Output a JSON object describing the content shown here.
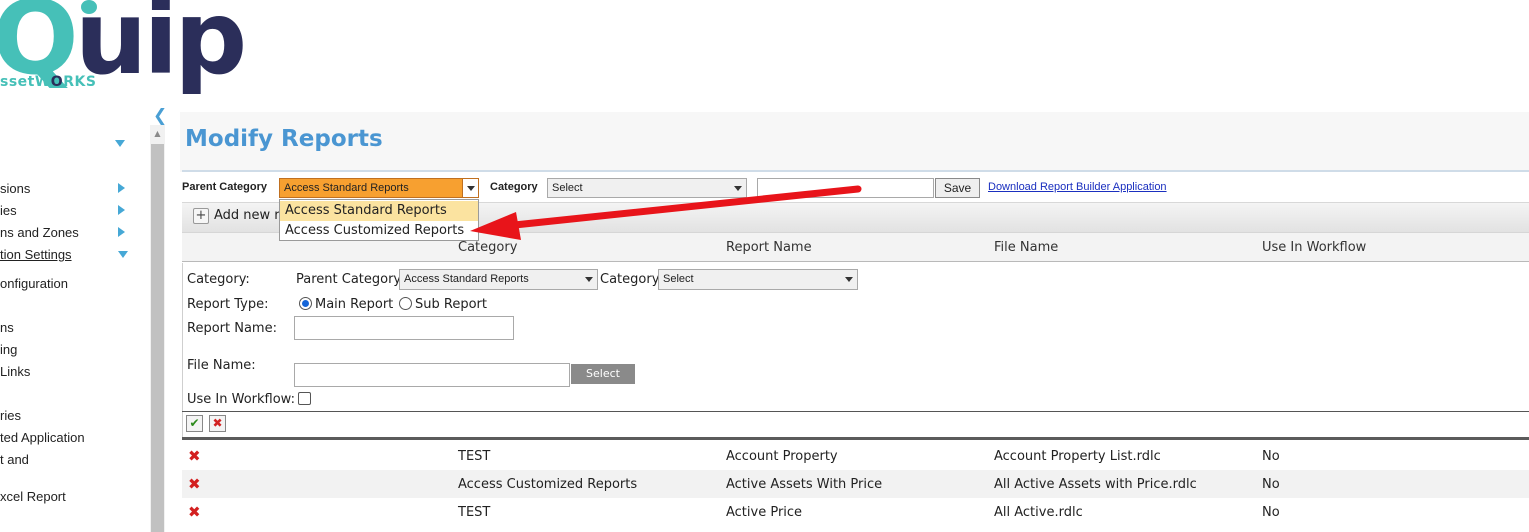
{
  "logo": {
    "word_first": "Q",
    "word_rest": "uip",
    "sub_prefix": "ssetW",
    "sub_o": "O",
    "sub_suffix": "RKS"
  },
  "sidebar": {
    "items": [
      {
        "label": "sions"
      },
      {
        "label": "ies"
      },
      {
        "label": "ns and Zones"
      },
      {
        "label": "tion Settings"
      },
      {
        "label": "onfiguration"
      },
      {
        "label": "ns"
      },
      {
        "label": "ing"
      },
      {
        "label": "Links"
      },
      {
        "label": "ries"
      },
      {
        "label": "ted Application"
      },
      {
        "label": "t and"
      },
      {
        "label": "xcel Report"
      }
    ]
  },
  "page": {
    "title": "Modify Reports"
  },
  "toolbar": {
    "parent_category_label": "Parent Category",
    "parent_category_value": "Access Standard Reports",
    "category_label": "Category",
    "category_value": "Select",
    "search_value": "",
    "save_label": "Save",
    "download_link": "Download Report Builder Application"
  },
  "dropdown": {
    "options": [
      "Access Standard Reports",
      "Access Customized Reports"
    ],
    "highlighted": "Access Standard Reports"
  },
  "grid": {
    "add_label": "Add new r",
    "columns": [
      "Category",
      "Report Name",
      "File Name",
      "Use In Workflow"
    ],
    "rows": [
      {
        "category": "TEST",
        "report_name": "Account Property",
        "file_name": "Account Property List.rdlc",
        "use_in_workflow": "No"
      },
      {
        "category": "Access Customized Reports",
        "report_name": "Active Assets With Price",
        "file_name": "All Active Assets with Price.rdlc",
        "use_in_workflow": "No"
      },
      {
        "category": "TEST",
        "report_name": "Active Price",
        "file_name": "All Active.rdlc",
        "use_in_workflow": "No"
      }
    ]
  },
  "form": {
    "category_label": "Category:",
    "parent_category_label": "Parent Category",
    "parent_category_value": "Access Standard Reports",
    "category_label2": "Category",
    "category_value": "Select",
    "report_type_label": "Report Type:",
    "main_report_label": "Main Report",
    "sub_report_label": "Sub Report",
    "report_name_label": "Report Name:",
    "report_name_value": "",
    "file_name_label": "File Name:",
    "file_name_value": "",
    "select_button": "Select",
    "use_in_workflow_label": "Use In Workflow:"
  },
  "colors": {
    "accent": "#4a96d2",
    "brand_teal": "#46c0b8",
    "brand_navy": "#2b2e5a",
    "annotation": "#e8141a"
  }
}
